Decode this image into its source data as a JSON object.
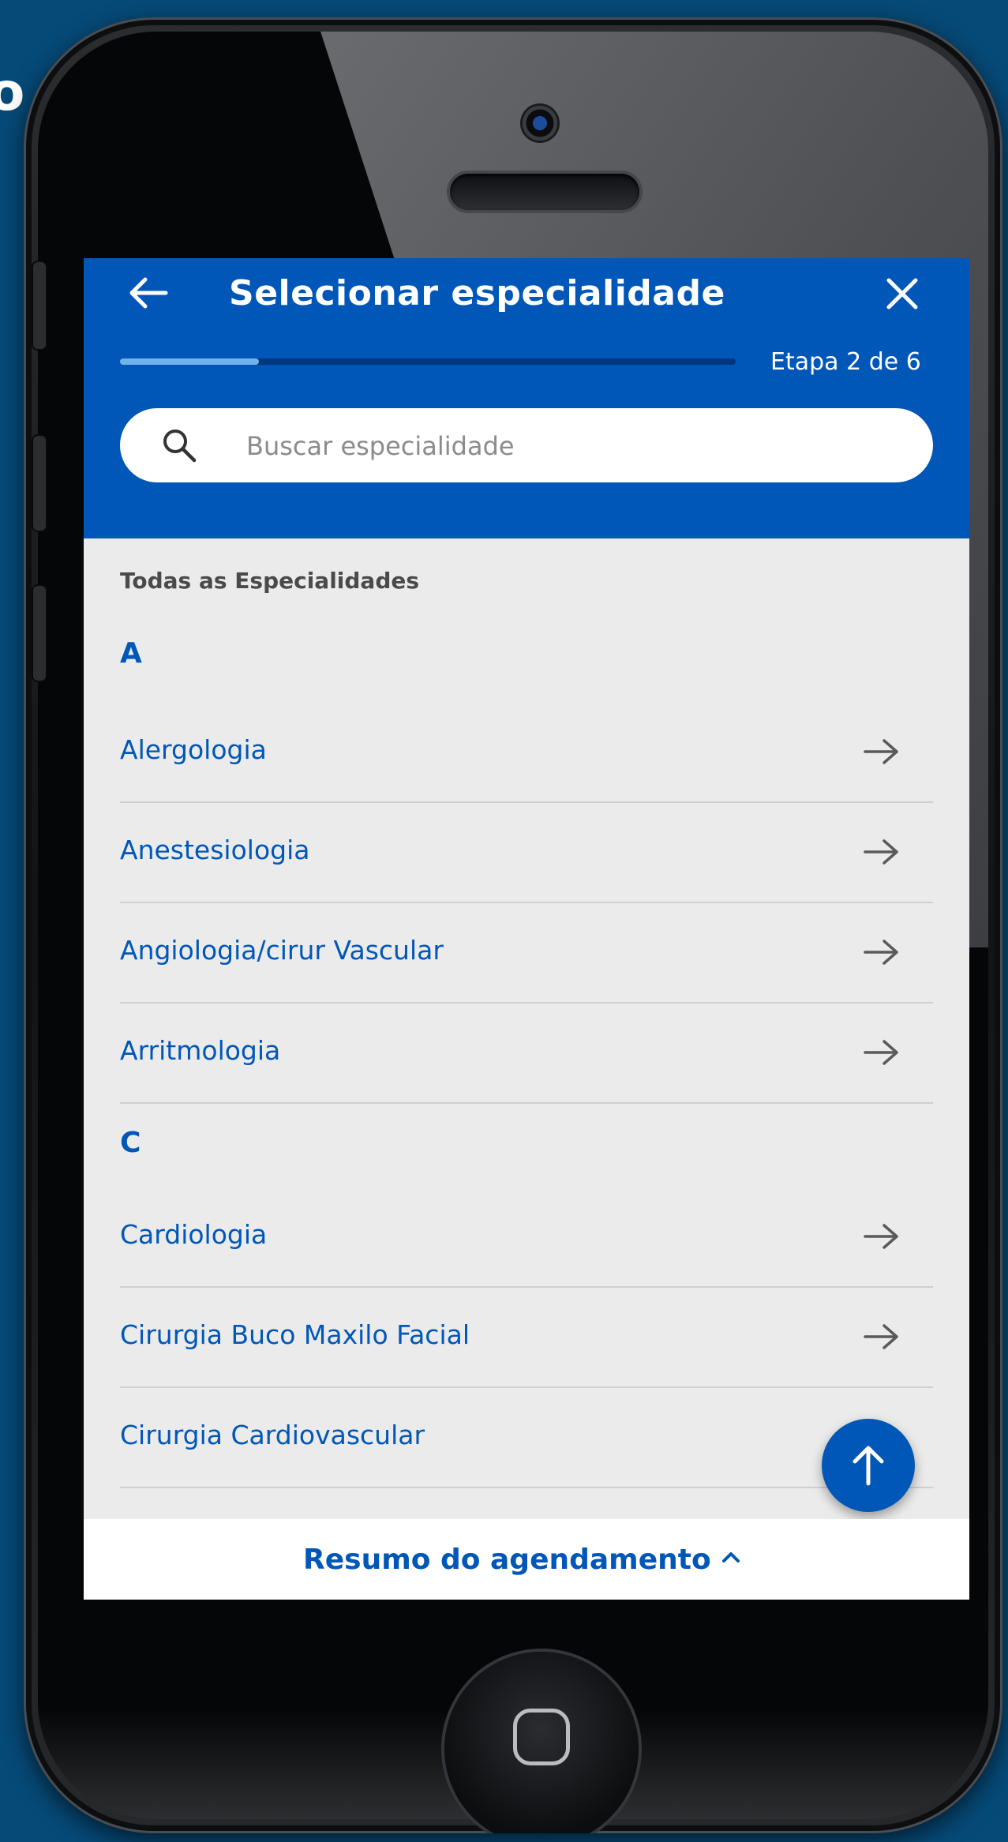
{
  "edge_glyph": "o",
  "header": {
    "title": "Selecionar especialidade",
    "step_label": "Etapa 2 de 6",
    "progress_fraction": 0.225,
    "back_icon": "arrow-left-icon",
    "close_icon": "close-icon"
  },
  "search": {
    "placeholder": "Buscar especialidade",
    "value": "",
    "icon": "search-icon"
  },
  "list": {
    "heading": "Todas as Especialidades",
    "groups": [
      {
        "letter": "A",
        "items": [
          "Alergologia",
          "Anestesiologia",
          "Angiologia/cirur Vascular",
          "Arritmologia"
        ]
      },
      {
        "letter": "C",
        "items": [
          "Cardiologia",
          "Cirurgia Buco Maxilo Facial",
          "Cirurgia Cardiovascular"
        ]
      }
    ]
  },
  "scroll_top_button": {
    "icon": "arrow-up-icon"
  },
  "footer": {
    "summary_label": "Resumo do agendamento",
    "chevron": "chevron-up-icon"
  },
  "colors": {
    "background": "#064a78",
    "header": "#0057b7",
    "progress_fill": "#6fb3ea",
    "progress_track": "#00377d",
    "list_background": "#ebebeb",
    "link_text": "#0057b7",
    "arrow": "#5a5a5a"
  }
}
